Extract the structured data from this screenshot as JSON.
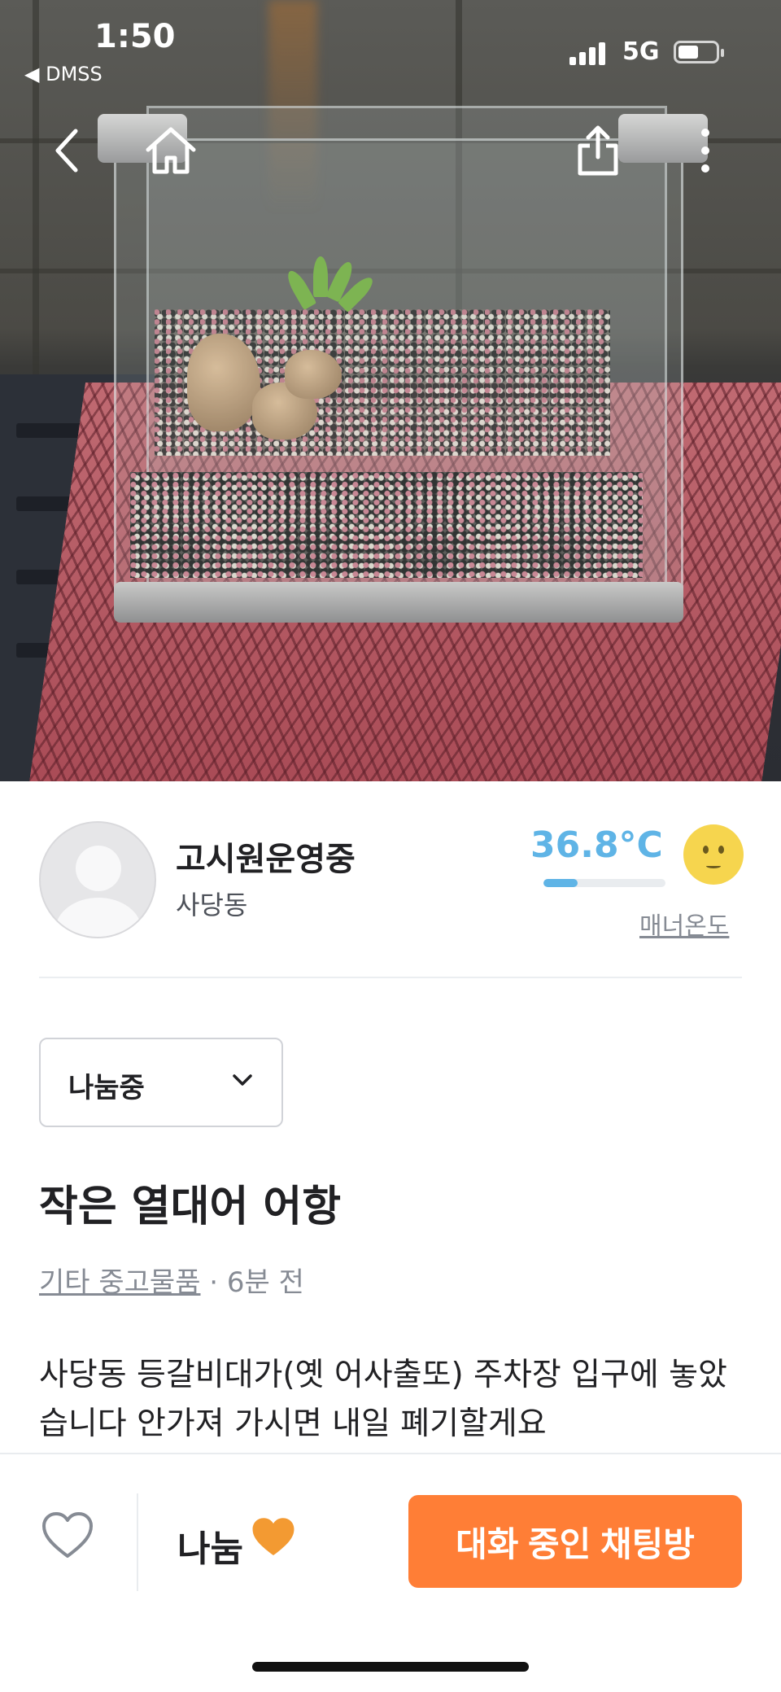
{
  "status_bar": {
    "time": "1:50",
    "back_app": "◀ DMSS",
    "network": "5G"
  },
  "nav": {
    "back_icon": "chevron-left-icon",
    "home_icon": "home-icon",
    "share_icon": "share-icon",
    "more_icon": "more-vertical-icon"
  },
  "seller": {
    "nickname": "고시원운영중",
    "region": "사당동",
    "temperature": "36.8°C",
    "temperature_fill_fraction": 0.28,
    "manner_label": "매너온도"
  },
  "listing": {
    "status_label": "나눔중",
    "title": "작은 열대어 어항",
    "category": "기타 중고물품",
    "time_ago": " · 6분 전",
    "description": "사당동 등갈비대가(옛 어사출또) 주차장 입구에 놓았습니다 안가져 가시면 내일 폐기할게요"
  },
  "bottom_bar": {
    "price_label": "나눔",
    "chat_button": "대화 중인 채팅방"
  },
  "colors": {
    "accent_orange": "#ff7e36",
    "temperature_blue": "#5fb4e6"
  }
}
